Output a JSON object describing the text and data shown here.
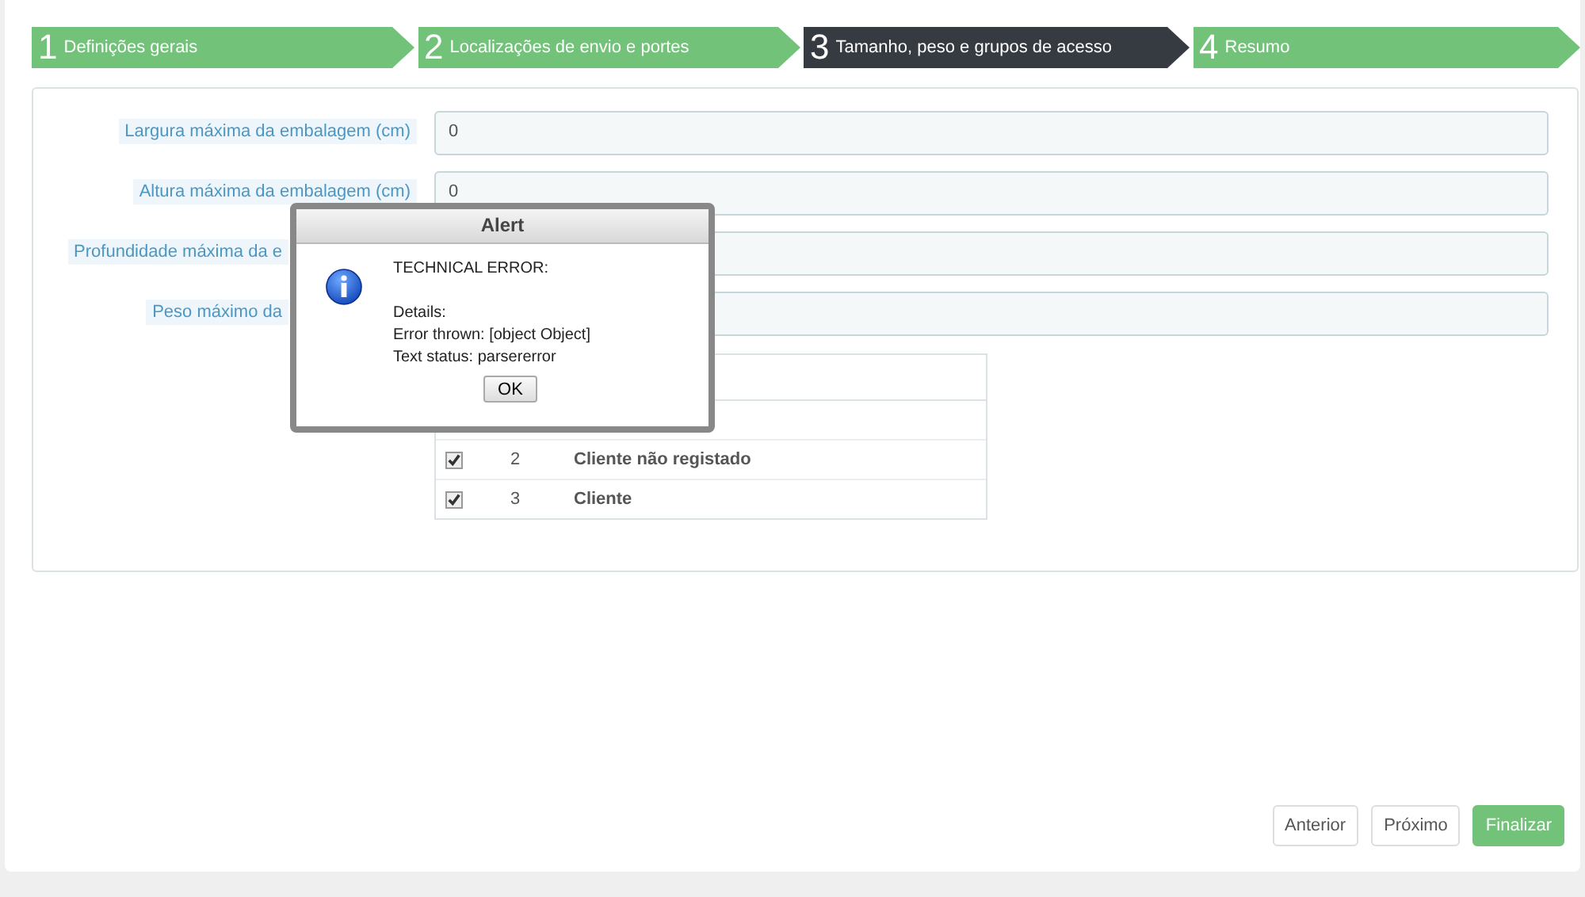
{
  "steps": [
    {
      "number": "1",
      "label": "Definições gerais",
      "selected": false
    },
    {
      "number": "2",
      "label": "Localizações de envio e portes",
      "selected": false
    },
    {
      "number": "3",
      "label": "Tamanho, peso e grupos de acesso",
      "selected": true
    },
    {
      "number": "4",
      "label": "Resumo",
      "selected": false
    }
  ],
  "fields": [
    {
      "label": "Largura máxima da embalagem (cm)",
      "value": "0"
    },
    {
      "label": "Altura máxima da embalagem (cm)",
      "value": "0"
    },
    {
      "label": "Profundidade máxima da e"
    },
    {
      "label": "Peso máximo da"
    }
  ],
  "groups": [
    {
      "checked": true,
      "id": "2",
      "name": "Cliente não registado"
    },
    {
      "checked": true,
      "id": "3",
      "name": "Cliente"
    }
  ],
  "dialog": {
    "title": "Alert",
    "heading": "TECHNICAL ERROR:",
    "lines": [
      "Details:",
      "Error thrown: [object Object]",
      "Text status: parsererror"
    ],
    "button": "OK"
  },
  "buttons": [
    {
      "label": "Anterior",
      "kind": "default"
    },
    {
      "label": "Próximo",
      "kind": "default"
    },
    {
      "label": "Finalizar",
      "kind": "primary"
    }
  ]
}
